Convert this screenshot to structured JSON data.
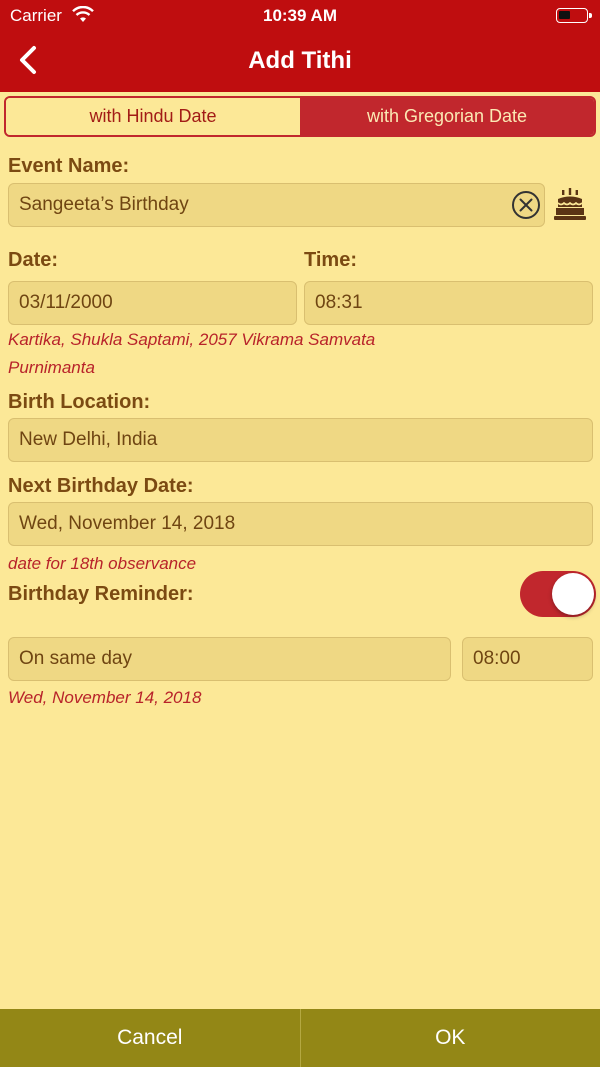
{
  "status_bar": {
    "carrier": "Carrier",
    "time": "10:39 AM"
  },
  "navbar": {
    "title": "Add Tithi",
    "back_icon": "chevron-left-icon"
  },
  "segments": [
    {
      "label": "with Hindu Date",
      "selected": true
    },
    {
      "label": "with Gregorian Date",
      "selected": false
    }
  ],
  "event": {
    "label": "Event Name:",
    "value": "Sangeeta’s Birthday",
    "clear_icon": "clear-circle-icon",
    "cake_icon": "birthday-cake-icon"
  },
  "date": {
    "label": "Date:",
    "value": "03/11/2000"
  },
  "time": {
    "label": "Time:",
    "value": "08:31"
  },
  "hindu_date": {
    "line1": "Kartika, Shukla Saptami, 2057 Vikrama Samvata",
    "line2": "Purnimanta"
  },
  "location": {
    "label": "Birth Location:",
    "value": "New Delhi, India"
  },
  "next_birthday": {
    "label": "Next Birthday Date:",
    "value": "Wed, November 14, 2018",
    "note": "date for 18th observance"
  },
  "reminder": {
    "label": "Birthday Reminder:",
    "enabled": true,
    "when": "On same day",
    "time": "08:00",
    "date_note": "Wed, November 14, 2018"
  },
  "actions": {
    "cancel": "Cancel",
    "ok": "OK"
  },
  "colors": {
    "header": "#bf0d0f",
    "background": "#fce897",
    "field": "#efd884",
    "accent": "#c1272d",
    "bottom_bar": "#938716",
    "label": "#7b4a12",
    "note": "#b8232a"
  }
}
